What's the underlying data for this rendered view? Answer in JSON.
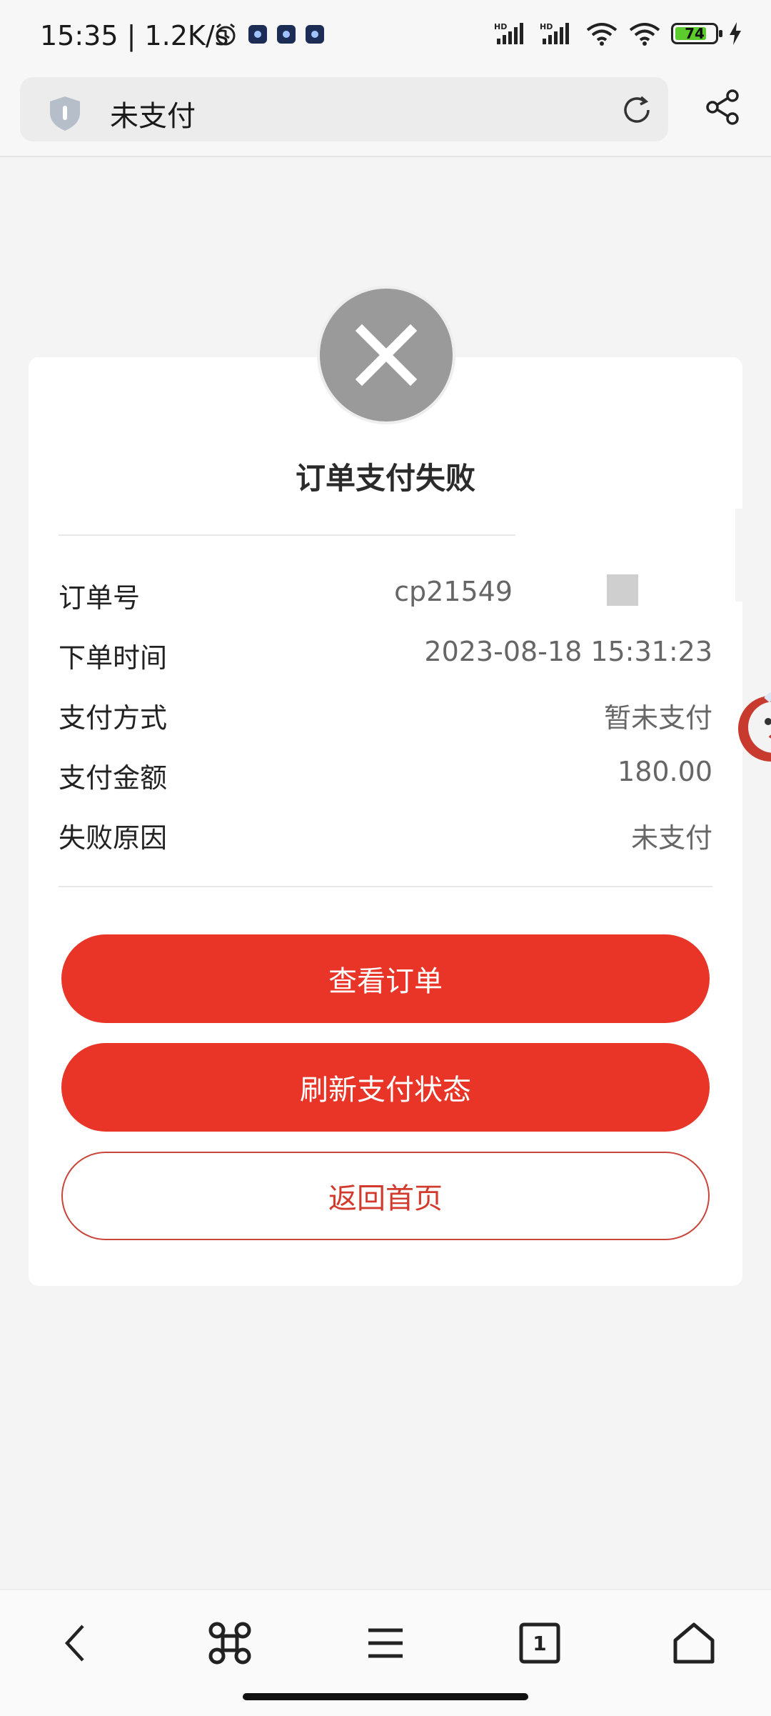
{
  "status_bar": {
    "time": "15:35",
    "speed": "1.2K/s",
    "battery_level": "74",
    "icons": [
      "alarm-icon",
      "app-icon",
      "app-icon",
      "app-icon",
      "hd-signal-icon",
      "hd-signal-icon",
      "wifi-icon",
      "wifi-icon",
      "battery-icon",
      "charging-icon"
    ]
  },
  "browser": {
    "title": "未支付"
  },
  "result": {
    "title": "订单支付失败",
    "rows": [
      {
        "label": "订单号",
        "value": "cp21549"
      },
      {
        "label": "下单时间",
        "value": "2023-08-18 15:31:23"
      },
      {
        "label": "支付方式",
        "value": "暂未支付"
      },
      {
        "label": "支付金额",
        "value": "180.00"
      },
      {
        "label": "失败原因",
        "value": "未支付"
      }
    ]
  },
  "buttons": {
    "view_order": "查看订单",
    "refresh_status": "刷新支付状态",
    "back_home": "返回首页"
  },
  "bottom_nav": {
    "tab_count": "1"
  },
  "colors": {
    "accent_red": "#e83528",
    "fail_gray": "#9a9a9a"
  }
}
